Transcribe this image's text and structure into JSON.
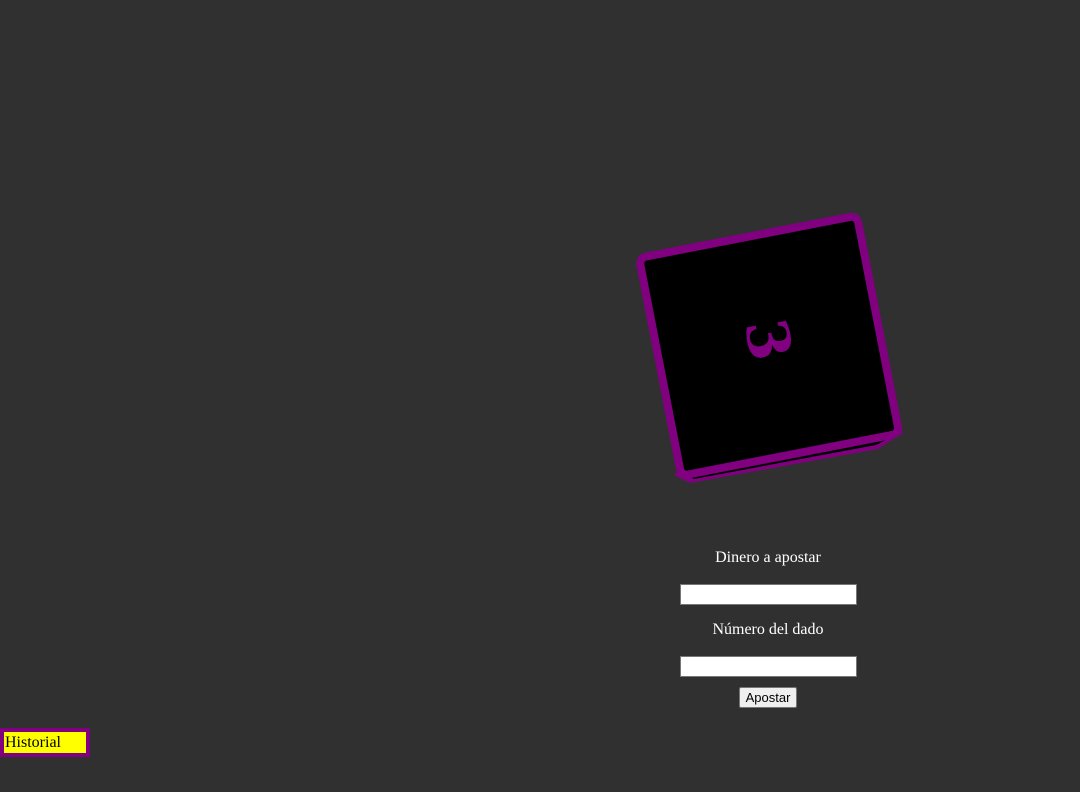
{
  "die": {
    "face_value": "3",
    "face_color": "#000000",
    "edge_color": "#800080",
    "number_color": "#800080"
  },
  "bet_form": {
    "amount_label": "Dinero a apostar",
    "amount_value": "",
    "number_label": "Número del dado",
    "number_value": "",
    "submit_label": "Apostar"
  },
  "history": {
    "label": "Historial",
    "background": "#ffff00",
    "border": "#800080"
  },
  "page": {
    "background": "#303030"
  }
}
